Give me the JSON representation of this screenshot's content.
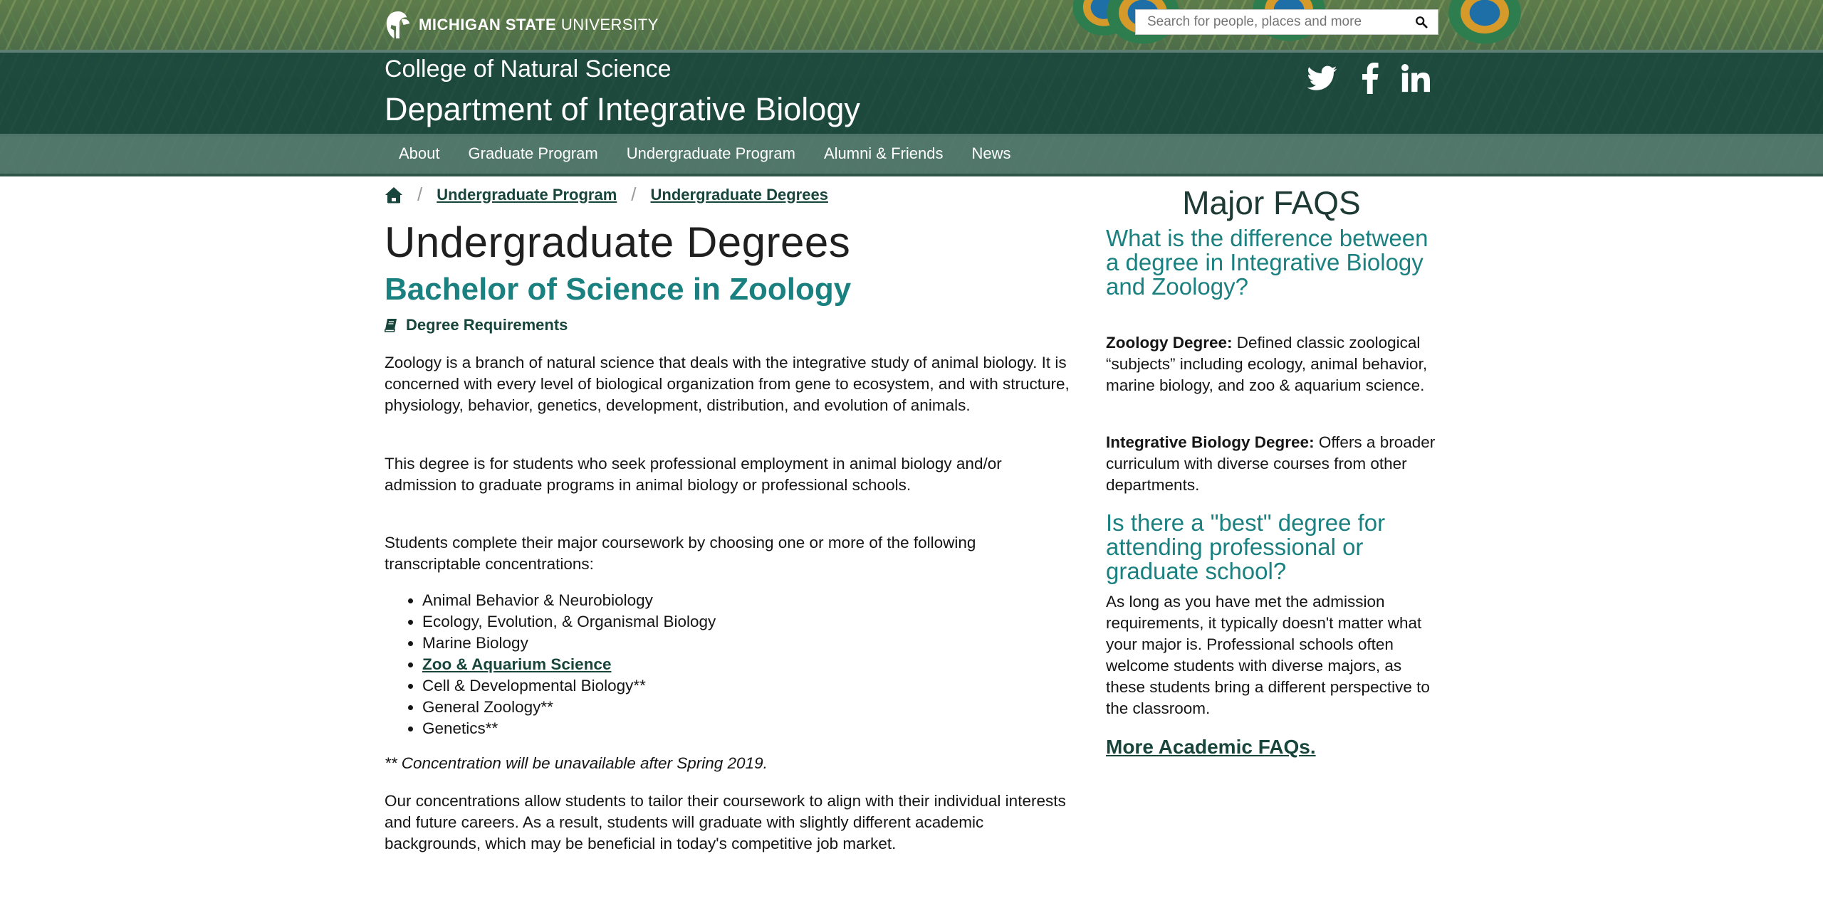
{
  "header": {
    "university_bold": "MICHIGAN STATE",
    "university_light": "UNIVERSITY",
    "search_placeholder": "Search for people, places and more",
    "college": "College of Natural Science",
    "department": "Department of Integrative Biology"
  },
  "social": [
    "twitter-icon",
    "facebook-icon",
    "linkedin-icon"
  ],
  "nav": {
    "items": [
      "About",
      "Graduate Program",
      "Undergraduate Program",
      "Alumni & Friends",
      "News"
    ]
  },
  "breadcrumb": {
    "items": [
      "Undergraduate Program",
      "Undergraduate Degrees"
    ]
  },
  "main": {
    "title": "Undergraduate Degrees",
    "degree": "Bachelor of Science in Zoology",
    "requirements_link": "Degree Requirements",
    "paragraphs": [
      "Zoology is a branch of natural science that deals with the integrative study of animal biology. It is concerned with every level of biological organization from gene to ecosystem, and with structure, physiology, behavior, genetics, development, distribution, and evolution of animals.",
      "This degree is for students who seek professional employment in animal biology and/or admission to graduate programs in animal biology or professional schools.",
      "Students complete their major coursework by choosing one or more of the following transcriptable concentrations:",
      "Our concentrations allow students to tailor their coursework to align with their individual interests and future careers. As a result, students will graduate with slightly different academic backgrounds, which may be beneficial in today's competitive job market."
    ],
    "concentrations": [
      "Animal Behavior & Neurobiology",
      "Ecology, Evolution, & Organismal Biology",
      "Marine Biology",
      "Zoo & Aquarium Science",
      "Cell & Developmental Biology**",
      "General Zoology**",
      "Genetics**"
    ],
    "note": "** Concentration will be unavailable after Spring 2019."
  },
  "sidebar": {
    "title": "Major FAQS",
    "q1": "What is the difference between a degree in Integrative Biology and Zoology?",
    "zoology_label": "Zoology Degree:",
    "zoology_text": " Defined classic zoological “subjects” including ecology, animal behavior, marine biology, and zoo & aquarium science.",
    "ib_label": "Integrative Biology Degree:",
    "ib_text": " Offers a broader curriculum with diverse courses from other departments.",
    "q2": "Is there a \"best\" degree for attending professional or graduate school?",
    "a2": "As long as you have met the admission requirements, it typically doesn't matter what your major is. Professional schools often welcome students with diverse majors, as these students bring a different perspective to the classroom.",
    "more_link": "More Academic FAQs."
  },
  "colors": {
    "msu_green": "#18453b",
    "teal_heading": "#1b8180",
    "nav_band": "#52786e"
  }
}
